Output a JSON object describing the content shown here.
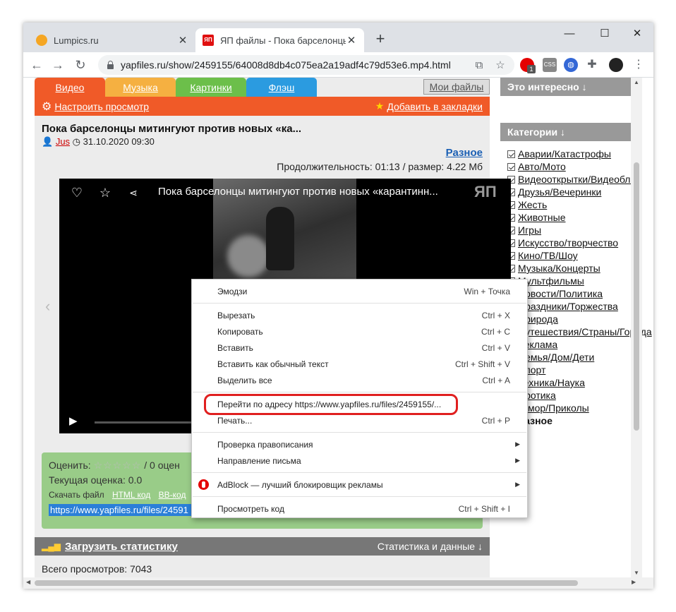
{
  "browser": {
    "tabs": [
      {
        "title": "Lumpics.ru",
        "favicon_color": "#f5a623"
      },
      {
        "title": "ЯП файлы - Пока барселонцы м",
        "favicon_text": "ЯП",
        "favicon_color": "#e01010"
      }
    ],
    "url": "yapfiles.ru/show/2459155/64008d8db4c075ea2a19adf4c79d53e6.mp4.html",
    "extensions": [
      "adblock-icon",
      "css-icon",
      "globe-icon",
      "puzzle-icon",
      "profile-avatar"
    ],
    "ext_badge": "1",
    "ext_css_label": "CSS"
  },
  "site": {
    "nav_tabs": [
      {
        "label": "Видео",
        "color": "#f05a28"
      },
      {
        "label": "Музыка",
        "color": "#f5b041"
      },
      {
        "label": "Картинки",
        "color": "#6cbf4a"
      },
      {
        "label": "Флэш",
        "color": "#2b9be0"
      }
    ],
    "my_files": "Мои файлы",
    "configure_view": "Настроить просмотр",
    "add_bookmarks": "Добавить в закладки",
    "page_title": "Пока барселонцы митингуют против новых «ка...",
    "author": "Jus",
    "date": "31.10.2020 09:30",
    "category_link": "Разное",
    "duration_line": "Продолжительность: 01:13 / размер: 4.22 Мб",
    "player": {
      "title": "Пока барселонцы митингуют против новых «карантинн...",
      "logo": "ЯП"
    },
    "rating": {
      "label": "Оценить:",
      "count": "/ 0 оцен",
      "current": "Текущая оценка: 0.0",
      "download": "Скачать файл",
      "html_code": "HTML код",
      "bb_code": "BB-код",
      "link": "https://www.yapfiles.ru/files/24591"
    },
    "stats": {
      "load": "Загрузить статистику",
      "right": "Статистика и данные ↓"
    },
    "views": "Всего просмотров: 7043"
  },
  "sidebar": {
    "interesting": "Это интересно ↓",
    "categories_title": "Категории ↓",
    "categories": [
      "Аварии/Катастрофы",
      "Авто/Мото",
      "Видеооткрытки/Видеоблог",
      "Друзья/Вечеринки",
      "Жесть",
      "Животные",
      "Игры",
      "Искусство/творчество",
      "Кино/ТВ/Шоу",
      "Музыка/Концерты",
      "Мультфильмы",
      "Новости/Политика",
      "Праздники/Торжества",
      "Природа",
      "Путешествия/Страны/Города",
      "Реклама",
      "Семья/Дом/Дети",
      "Спорт",
      "Техника/Наука",
      "Эротика",
      "Юмор/Приколы",
      "Разное"
    ]
  },
  "context_menu": {
    "emoji": {
      "label": "Эмодзи",
      "shortcut": "Win + Точка"
    },
    "cut": {
      "label": "Вырезать",
      "shortcut": "Ctrl + X"
    },
    "copy": {
      "label": "Копировать",
      "shortcut": "Ctrl + C"
    },
    "paste": {
      "label": "Вставить",
      "shortcut": "Ctrl + V"
    },
    "paste_plain": {
      "label": "Вставить как обычный текст",
      "shortcut": "Ctrl + Shift + V"
    },
    "select_all": {
      "label": "Выделить все",
      "shortcut": "Ctrl + A"
    },
    "goto": {
      "label": "Перейти по адресу https://www.yapfiles.ru/files/2459155/..."
    },
    "print": {
      "label": "Печать...",
      "shortcut": "Ctrl + P"
    },
    "spellcheck": {
      "label": "Проверка правописания"
    },
    "direction": {
      "label": "Направление письма"
    },
    "adblock": {
      "label": "AdBlock — лучший блокировщик рекламы"
    },
    "inspect": {
      "label": "Просмотреть код",
      "shortcut": "Ctrl + Shift + I"
    }
  }
}
